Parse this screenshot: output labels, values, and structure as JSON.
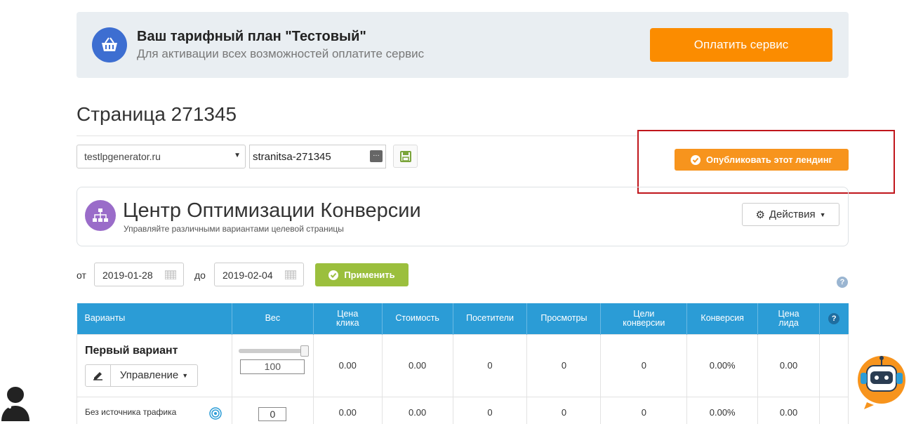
{
  "banner": {
    "title": "Ваш тарифный план \"Тестовый\"",
    "subtitle": "Для активации всех возможностей оплатите сервис",
    "pay_button": "Оплатить сервис"
  },
  "page": {
    "title": "Страница 271345"
  },
  "url_bar": {
    "domain": "testlpgenerator.ru",
    "slug": "stranitsa-271345",
    "publish_button": "Опубликовать этот лендинг"
  },
  "cro": {
    "title": "Центр Оптимизации Конверсии",
    "subtitle": "Управляйте различными вариантами целевой страницы",
    "actions_button": "Действия"
  },
  "date_filter": {
    "from_label": "от",
    "from_value": "2019-01-28",
    "to_label": "до",
    "to_value": "2019-02-04",
    "apply_button": "Применить"
  },
  "table": {
    "headers": [
      "Варианты",
      "Вес",
      "Цена\nклика",
      "Стоимость",
      "Посетители",
      "Просмотры",
      "Цели\nконверсии",
      "Конверсия",
      "Цена\nлида"
    ],
    "help_symbol": "?",
    "rows": [
      {
        "name": "Первый вариант",
        "manage_label": "Управление",
        "weight": "100",
        "weight_fraction": 1.0,
        "click_price": "0.00",
        "cost": "0.00",
        "visitors": "0",
        "views": "0",
        "goals": "0",
        "conversion": "0.00%",
        "lead_price": "0.00"
      },
      {
        "name": "Без источника трафика",
        "weight": "0",
        "click_price": "0.00",
        "cost": "0",
        "visitors": "0",
        "views": "0",
        "goals": "0",
        "conversion": "0.00%",
        "lead_price": "0.00"
      }
    ]
  },
  "colors": {
    "orange": "#fb8c00",
    "table_header": "#2b9cd6",
    "apply_green": "#9bbf3d",
    "highlight_red": "#c0161c"
  }
}
